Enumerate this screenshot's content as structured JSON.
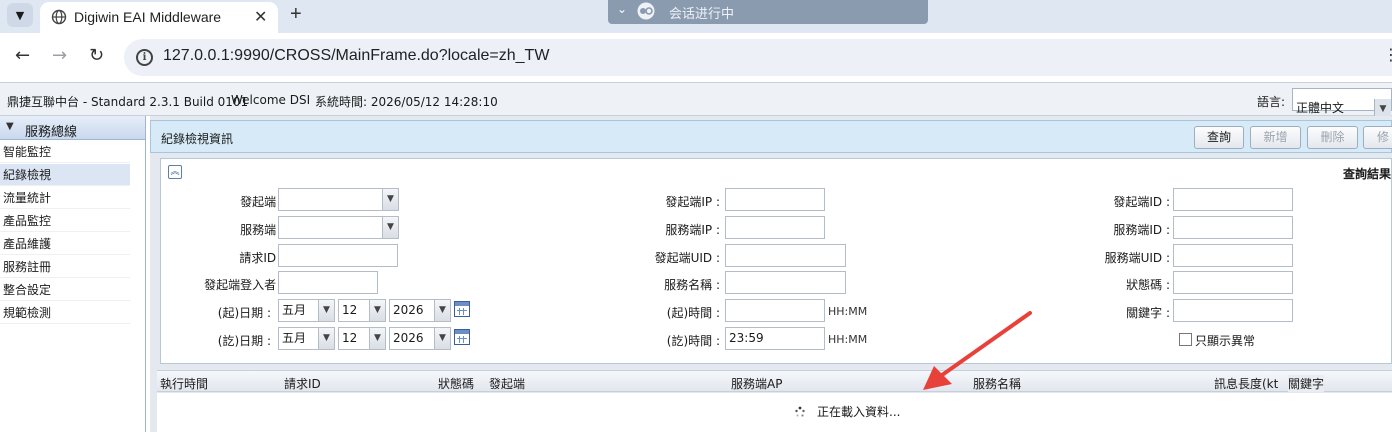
{
  "browser": {
    "tab_title": "Digiwin EAI Middleware",
    "session_banner": "会话进行中",
    "url": "127.0.0.1:9990/CROSS/MainFrame.do?locale=zh_TW"
  },
  "header": {
    "product": "鼎捷互聯中台 - Standard 2.3.1 Build 0101",
    "welcome": "Welcome DSI",
    "system_time": "系統時間: 2026/05/12 14:28:10",
    "language_label": "語言:",
    "language_value": "正體中文"
  },
  "sidebar": {
    "title": "服務總線",
    "items": [
      {
        "label": "智能監控"
      },
      {
        "label": "紀錄檢視"
      },
      {
        "label": "流量統計"
      },
      {
        "label": "產品監控"
      },
      {
        "label": "產品維護"
      },
      {
        "label": "服務註冊"
      },
      {
        "label": "整合設定"
      },
      {
        "label": "規範檢測"
      }
    ]
  },
  "main": {
    "title": "紀錄檢視資訊",
    "buttons": {
      "query": "查詢",
      "add": "新增",
      "delete": "刪除",
      "modify": "修"
    },
    "results_label": "查詢結果",
    "form": {
      "initiator": "發起端 :",
      "service_side": "服務端 :",
      "request_id": "請求ID :",
      "initiator_login": "發起端登入者 :",
      "start_date": "(起)日期 :",
      "end_date": "(訖)日期 :",
      "initiator_ip": "發起端IP :",
      "service_ip": "服務端IP :",
      "initiator_uid": "發起端UID :",
      "service_name": "服務名稱 :",
      "start_time": "(起)時間 :",
      "end_time": "(訖)時間 :",
      "end_time_value": "23:59",
      "time_hint": "HH:MM",
      "initiator_id": "發起端ID :",
      "service_id": "服務端ID :",
      "service_uid": "服務端UID :",
      "status_code": "狀態碼 :",
      "keyword": "關鍵字 :",
      "only_errors": "只顯示異常",
      "month_value": "五月",
      "day_value": "12",
      "year_value": "2026"
    },
    "grid": {
      "columns": [
        "執行時間",
        "請求ID",
        "狀態碼",
        "發起端",
        "服務端AP",
        "服務名稱",
        "訊息長度(kt",
        "關鍵字"
      ],
      "loading_text": "正在載入資料..."
    }
  },
  "colors": {
    "arrow": "#e8413a",
    "header_bar": "#d6ebf7",
    "sidebar_active": "#dbe5f3"
  }
}
